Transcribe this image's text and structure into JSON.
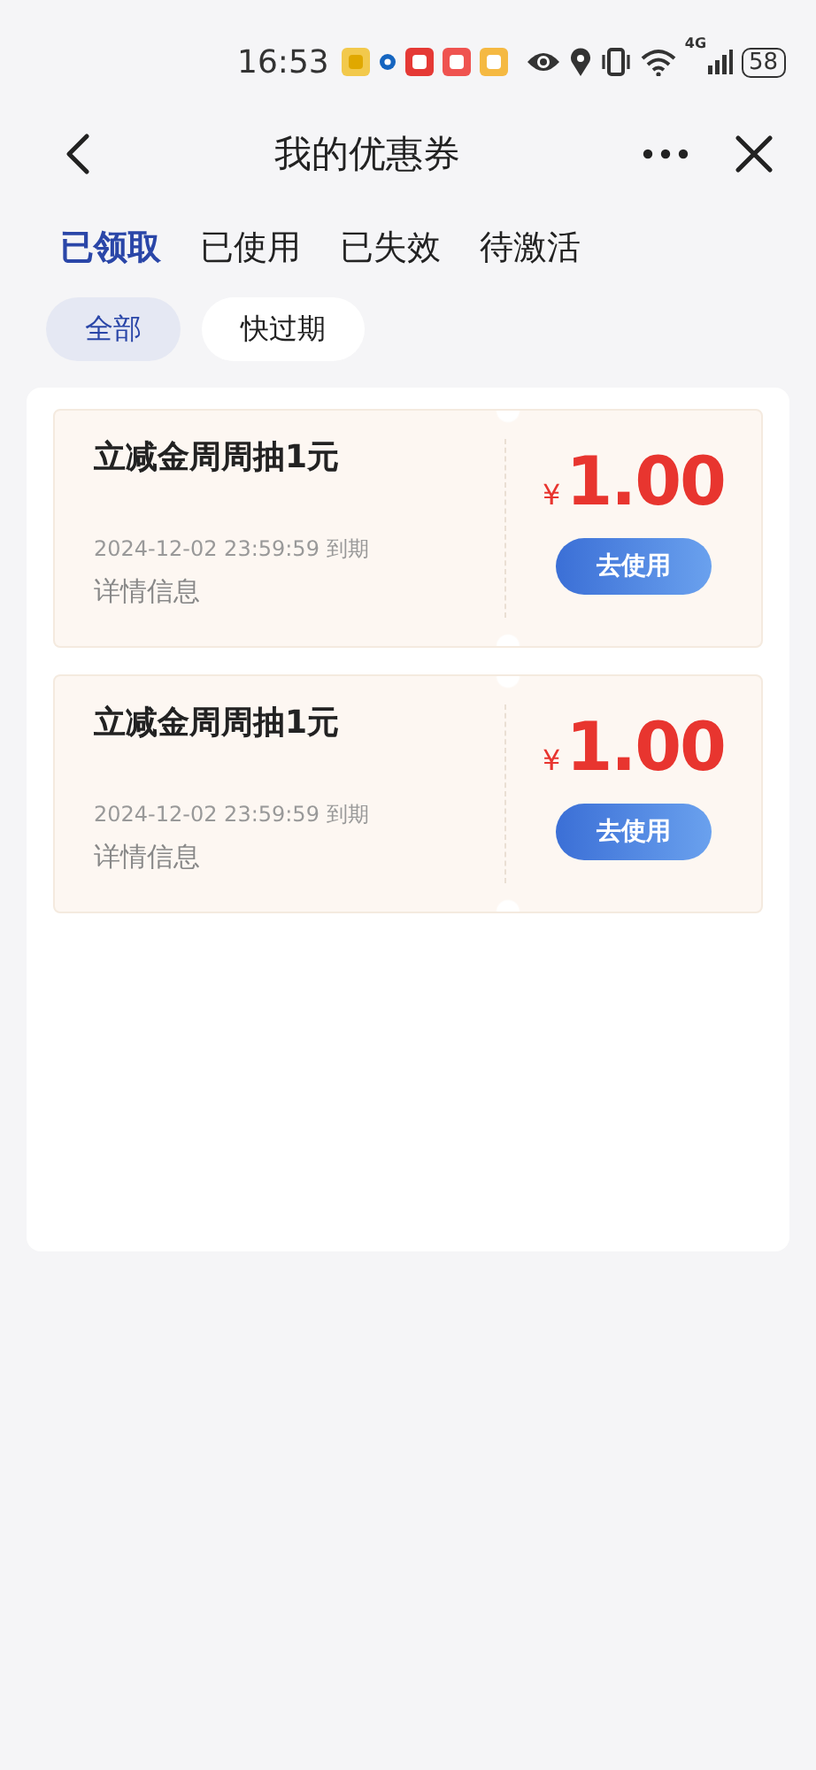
{
  "status_bar": {
    "time": "16:53",
    "network": "4G",
    "battery": "58"
  },
  "nav": {
    "title": "我的优惠券"
  },
  "tabs": [
    {
      "label": "已领取",
      "selected": true
    },
    {
      "label": "已使用",
      "selected": false
    },
    {
      "label": "已失效",
      "selected": false
    },
    {
      "label": "待激活",
      "selected": false
    }
  ],
  "filters": [
    {
      "label": "全部",
      "selected": true
    },
    {
      "label": "快过期",
      "selected": false
    }
  ],
  "coupons": [
    {
      "title": "立减金周周抽1元",
      "currency": "¥",
      "amount": "1.00",
      "expiry": "2024-12-02 23:59:59 到期",
      "details": "详情信息",
      "button": "去使用"
    },
    {
      "title": "立减金周周抽1元",
      "currency": "¥",
      "amount": "1.00",
      "expiry": "2024-12-02 23:59:59 到期",
      "details": "详情信息",
      "button": "去使用"
    }
  ]
}
